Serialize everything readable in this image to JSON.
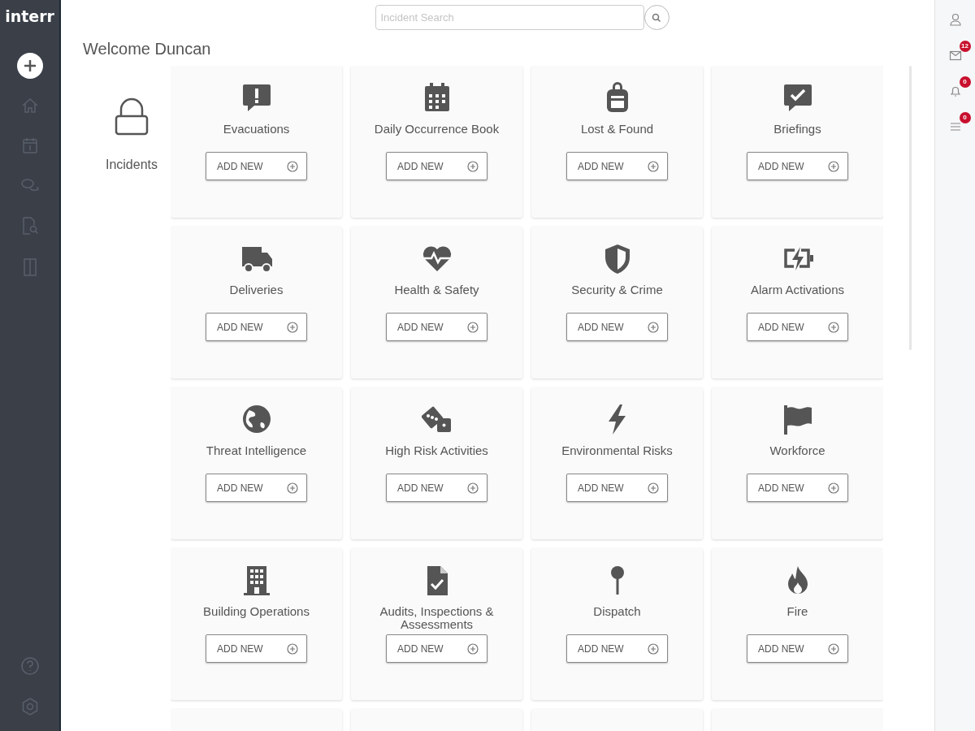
{
  "brand": "interr",
  "search": {
    "placeholder": "Incident Search"
  },
  "welcome": "Welcome Duncan",
  "category": {
    "label": "Incidents"
  },
  "cards": [
    {
      "label": "Evacuations",
      "button": "ADD NEW"
    },
    {
      "label": "Daily Occurrence Book",
      "button": "ADD NEW"
    },
    {
      "label": "Lost & Found",
      "button": "ADD NEW"
    },
    {
      "label": "Briefings",
      "button": "ADD NEW"
    },
    {
      "label": "Deliveries",
      "button": "ADD NEW"
    },
    {
      "label": "Health & Safety",
      "button": "ADD NEW"
    },
    {
      "label": "Security & Crime",
      "button": "ADD NEW"
    },
    {
      "label": "Alarm Activations",
      "button": "ADD NEW"
    },
    {
      "label": "Threat Intelligence",
      "button": "ADD NEW"
    },
    {
      "label": "High Risk Activities",
      "button": "ADD NEW"
    },
    {
      "label": "Environmental Risks",
      "button": "ADD NEW"
    },
    {
      "label": "Workforce",
      "button": "ADD NEW"
    },
    {
      "label": "Building Operations",
      "button": "ADD NEW"
    },
    {
      "label": "Audits, Inspections & Assessments",
      "button": "ADD NEW"
    },
    {
      "label": "Dispatch",
      "button": "ADD NEW"
    },
    {
      "label": "Fire",
      "button": "ADD NEW"
    }
  ],
  "right_rail": {
    "badges": [
      "12",
      "0",
      "0"
    ]
  }
}
